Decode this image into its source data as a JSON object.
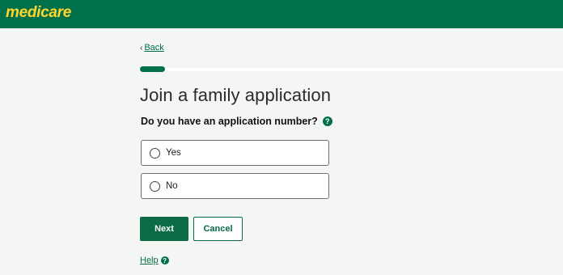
{
  "header": {
    "logo_text": "medicare",
    "brand_color": "#00704a",
    "logo_color": "#ffd52e"
  },
  "nav": {
    "back_label": "Back"
  },
  "progress": {
    "fraction": 0.06
  },
  "page": {
    "title": "Join a family application",
    "question": "Do you have an application number?",
    "help_icon": "?"
  },
  "options": [
    {
      "label": "Yes",
      "selected": false
    },
    {
      "label": "No",
      "selected": false
    }
  ],
  "actions": {
    "next_label": "Next",
    "cancel_label": "Cancel"
  },
  "footer": {
    "help_label": "Help",
    "help_icon": "?"
  }
}
